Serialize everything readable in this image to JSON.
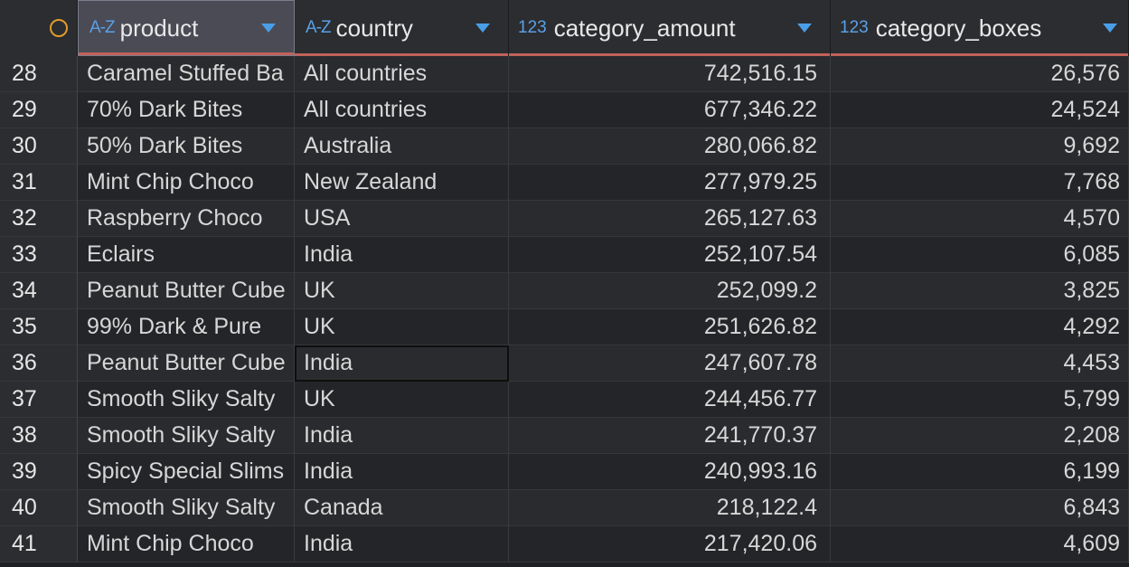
{
  "header": {
    "columns": [
      {
        "type": "A-Z",
        "label": "product"
      },
      {
        "type": "A-Z",
        "label": "country"
      },
      {
        "type": "123",
        "label": "category_amount"
      },
      {
        "type": "123",
        "label": "category_boxes"
      }
    ]
  },
  "rows": [
    {
      "idx": "28",
      "product": "Caramel Stuffed Ba",
      "country": "All countries",
      "amount": "742,516.15",
      "boxes": "26,576"
    },
    {
      "idx": "29",
      "product": "70% Dark Bites",
      "country": "All countries",
      "amount": "677,346.22",
      "boxes": "24,524"
    },
    {
      "idx": "30",
      "product": "50% Dark Bites",
      "country": "Australia",
      "amount": "280,066.82",
      "boxes": "9,692"
    },
    {
      "idx": "31",
      "product": "Mint Chip Choco",
      "country": "New Zealand",
      "amount": "277,979.25",
      "boxes": "7,768"
    },
    {
      "idx": "32",
      "product": "Raspberry Choco",
      "country": "USA",
      "amount": "265,127.63",
      "boxes": "4,570"
    },
    {
      "idx": "33",
      "product": "Eclairs",
      "country": "India",
      "amount": "252,107.54",
      "boxes": "6,085"
    },
    {
      "idx": "34",
      "product": "Peanut Butter Cube",
      "country": "UK",
      "amount": "252,099.2",
      "boxes": "3,825"
    },
    {
      "idx": "35",
      "product": "99% Dark & Pure",
      "country": "UK",
      "amount": "251,626.82",
      "boxes": "4,292"
    },
    {
      "idx": "36",
      "product": "Peanut Butter Cube",
      "country": "India",
      "amount": "247,607.78",
      "boxes": "4,453"
    },
    {
      "idx": "37",
      "product": "Smooth Sliky Salty",
      "country": "UK",
      "amount": "244,456.77",
      "boxes": "5,799"
    },
    {
      "idx": "38",
      "product": "Smooth Sliky Salty",
      "country": "India",
      "amount": "241,770.37",
      "boxes": "2,208"
    },
    {
      "idx": "39",
      "product": "Spicy Special Slims",
      "country": "India",
      "amount": "240,993.16",
      "boxes": "6,199"
    },
    {
      "idx": "40",
      "product": "Smooth Sliky Salty",
      "country": "Canada",
      "amount": "218,122.4",
      "boxes": "6,843"
    },
    {
      "idx": "41",
      "product": "Mint Chip Choco",
      "country": "India",
      "amount": "217,420.06",
      "boxes": "4,609"
    }
  ],
  "colors": {
    "accent": "#5aa0e6",
    "header_underline": "#c0625a",
    "row_number_icon": "#e29a2c"
  }
}
